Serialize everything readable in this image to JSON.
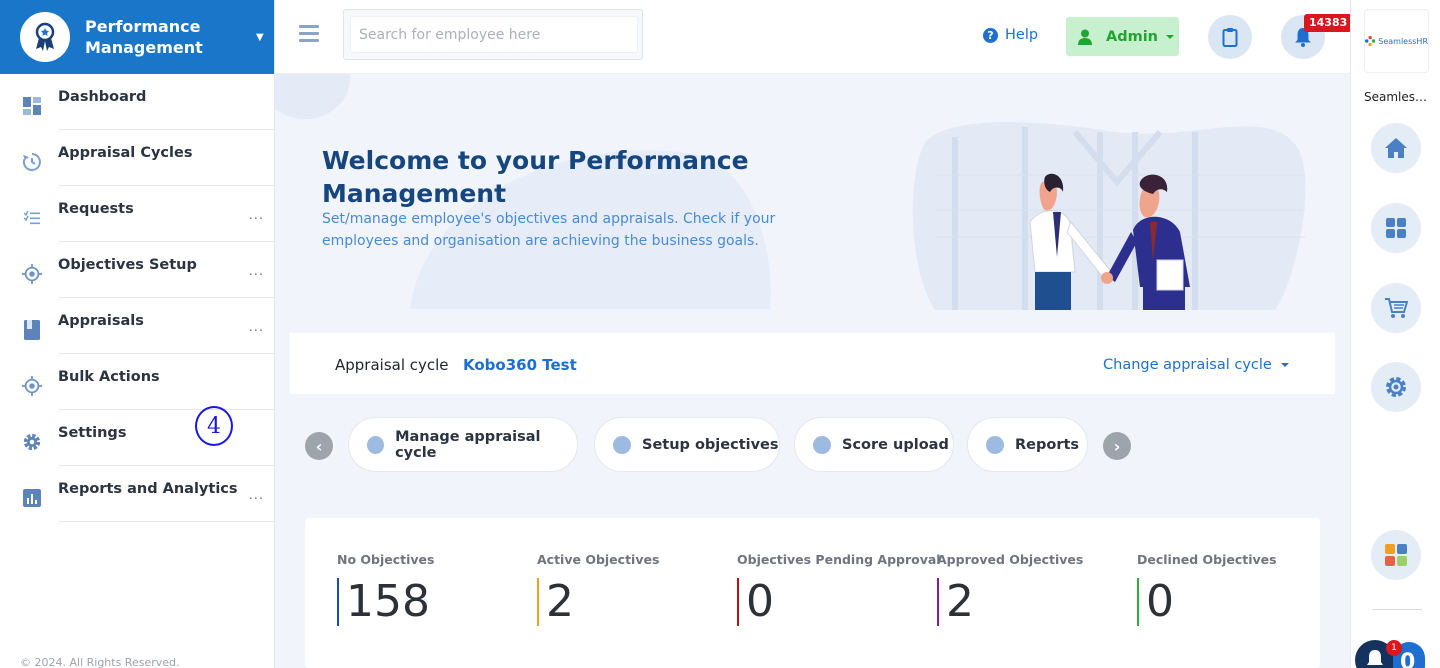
{
  "sidebar": {
    "title": "Performance Management",
    "items": [
      {
        "label": "Dashboard",
        "icon": "dashboard-icon",
        "has_more": false
      },
      {
        "label": "Appraisal Cycles",
        "icon": "cycle-icon",
        "has_more": false
      },
      {
        "label": "Requests",
        "icon": "checklist-icon",
        "has_more": true
      },
      {
        "label": "Objectives Setup",
        "icon": "target-icon",
        "has_more": true
      },
      {
        "label": "Appraisals",
        "icon": "book-icon",
        "has_more": true
      },
      {
        "label": "Bulk Actions",
        "icon": "target-icon",
        "has_more": false
      },
      {
        "label": "Settings",
        "icon": "gear-icon",
        "has_more": false
      },
      {
        "label": "Reports and Analytics",
        "icon": "bar-chart-icon",
        "has_more": true
      }
    ],
    "more_glyph": "...",
    "step_marker": "4",
    "footer": "© 2024. All Rights Reserved."
  },
  "topbar": {
    "search_placeholder": "Search for employee here",
    "help_label": "Help",
    "admin_label": "Admin",
    "notification_count": "14383"
  },
  "hero": {
    "title": "Welcome to your Performance Management",
    "subtitle": "Set/manage employee's objectives and appraisals. Check if your employees and organisation are achieving the business goals."
  },
  "cycle": {
    "label": "Appraisal cycle",
    "value": "Kobo360 Test",
    "change_label": "Change appraisal cycle"
  },
  "quick_actions": [
    {
      "label": "Manage appraisal cycle"
    },
    {
      "label": "Setup objectives"
    },
    {
      "label": "Score upload"
    },
    {
      "label": "Reports"
    }
  ],
  "stats": [
    {
      "label": "No Objectives",
      "value": "158",
      "color": "#1b4ea1"
    },
    {
      "label": "Active Objectives",
      "value": "2",
      "color": "#f0a020"
    },
    {
      "label": "Objectives Pending Approval",
      "value": "0",
      "color": "#b0151c"
    },
    {
      "label": "Approved Objectives",
      "value": "2",
      "color": "#8a1a8f"
    },
    {
      "label": "Declined Objectives",
      "value": "0",
      "color": "#2bae3a"
    }
  ],
  "rail": {
    "brand": "SeamlessHR",
    "app_name": "Seamless...",
    "chat_badge": "1",
    "chat_count": "0"
  },
  "colors": {
    "primary": "#1976c9",
    "accent_blue": "#1e6fd0",
    "title_navy": "#15467f",
    "admin_green": "#23a431",
    "badge_red": "#d8171e"
  }
}
